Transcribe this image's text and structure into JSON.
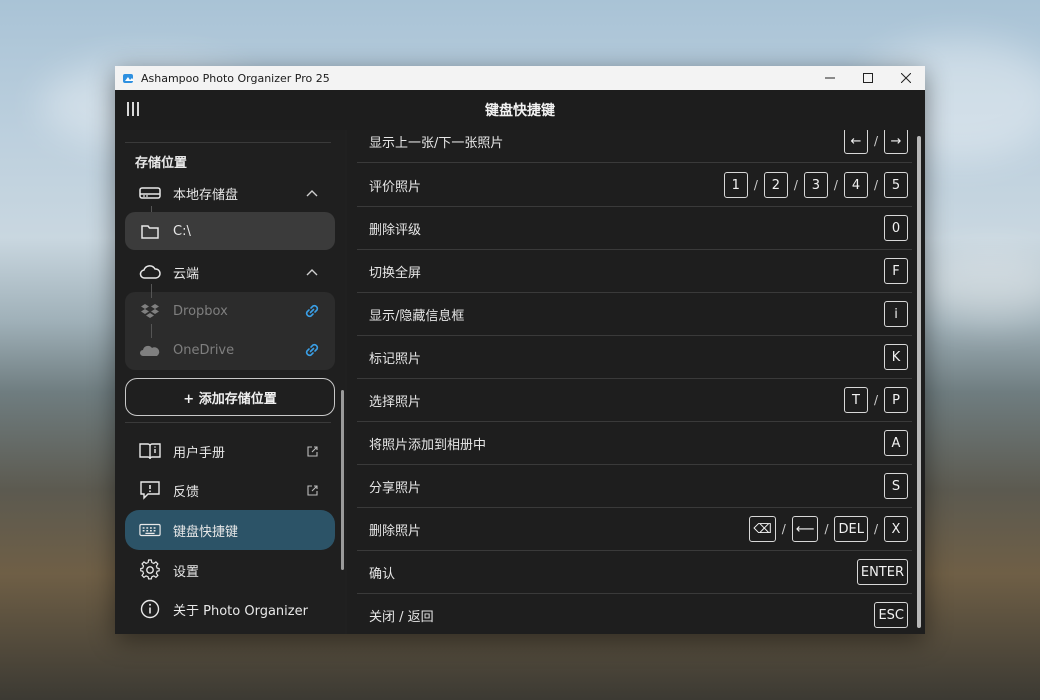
{
  "window": {
    "title": "Ashampoo Photo Organizer Pro 25",
    "controls": [
      "minimize",
      "maximize",
      "close"
    ]
  },
  "header": {
    "title": "键盘快捷键"
  },
  "sidebar": {
    "section_title": "存储位置",
    "local": {
      "label": "本地存储盘",
      "icon": "drive-icon",
      "expanded": true,
      "drive": "C:\\"
    },
    "cloud": {
      "label": "云端",
      "icon": "cloud-icon",
      "expanded": true,
      "dropbox": "Dropbox",
      "onedrive": "OneDrive"
    },
    "add_location": "+ 添加存储位置",
    "manual": "用户手册",
    "feedback": "反馈",
    "shortcuts": "键盘快捷键",
    "settings": "设置",
    "about": "关于 Photo Organizer",
    "accent_color": "#2c5367",
    "link_color": "#3aa0e8"
  },
  "shortcuts": [
    {
      "name": "显示上一张/下一张照片",
      "keys": [
        "←",
        "→"
      ]
    },
    {
      "name": "评价照片",
      "keys": [
        "1",
        "2",
        "3",
        "4",
        "5"
      ]
    },
    {
      "name": "删除评级",
      "keys": [
        "0"
      ]
    },
    {
      "name": "切换全屏",
      "keys": [
        "F"
      ]
    },
    {
      "name": "显示/隐藏信息框",
      "keys": [
        "i"
      ]
    },
    {
      "name": "标记照片",
      "keys": [
        "K"
      ]
    },
    {
      "name": "选择照片",
      "keys": [
        "T",
        "P"
      ]
    },
    {
      "name": "将照片添加到相册中",
      "keys": [
        "A"
      ]
    },
    {
      "name": "分享照片",
      "keys": [
        "S"
      ]
    },
    {
      "name": "删除照片",
      "keys": [
        "⌫",
        "⟵",
        "DEL",
        "X"
      ]
    },
    {
      "name": "确认",
      "keys": [
        "ENTER"
      ]
    },
    {
      "name": "关闭 / 返回",
      "keys": [
        "ESC"
      ]
    }
  ],
  "key_separator": "/"
}
